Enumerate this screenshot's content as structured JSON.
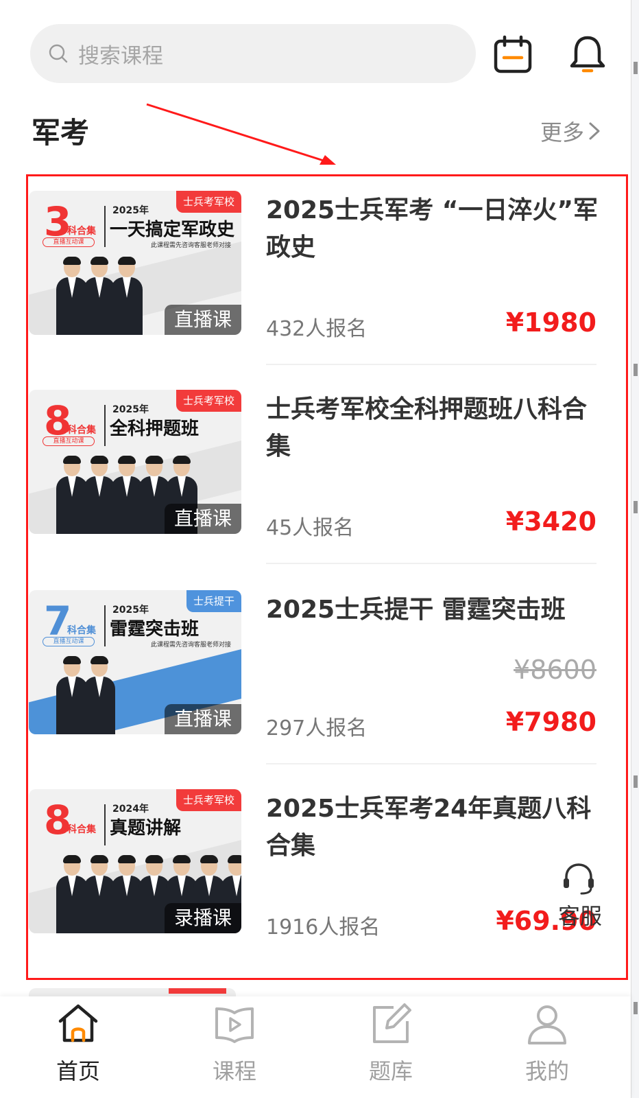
{
  "search": {
    "placeholder": "搜索课程"
  },
  "section": {
    "title": "军考",
    "more": "更多"
  },
  "courses": [
    {
      "title": "2025士兵军考 “一日淬火”军政史",
      "enroll": "432人报名",
      "price": "¥1980",
      "badge": "直播课",
      "thumb": {
        "tag": "士兵考军校",
        "num": "3",
        "kehe": "科合集",
        "live": "直播互动课",
        "year": "2025年",
        "headline": "一天搞定军政史",
        "sub": "此课程需先咨询客服老师对接"
      }
    },
    {
      "title": "士兵考军校全科押题班八科合集",
      "enroll": "45人报名",
      "price": "¥3420",
      "badge": "直播课",
      "thumb": {
        "tag": "士兵考军校",
        "num": "8",
        "kehe": "科合集",
        "live": "直播互动课",
        "year": "2025年",
        "headline": "全科押题班",
        "sub": ""
      }
    },
    {
      "title": "2025士兵提干 雷霆突击班",
      "enroll": "297人报名",
      "orig_price": "¥8600",
      "price": "¥7980",
      "badge": "直播课",
      "thumb": {
        "tag": "士兵提干",
        "num": "7",
        "kehe": "科合集",
        "live": "直播互动课",
        "year": "2025年",
        "headline": "雷霆突击班",
        "sub": "此课程需先咨询客服老师对接"
      }
    },
    {
      "title": "2025士兵军考24年真题八科合集",
      "enroll": "1916人报名",
      "price": "¥69.90",
      "badge": "录播课",
      "thumb": {
        "tag": "士兵考军校",
        "num": "8",
        "kehe": "科合集",
        "live": "",
        "year": "2024年",
        "headline": "真题讲解",
        "sub": ""
      }
    }
  ],
  "service": {
    "label": "客服"
  },
  "tabs": [
    {
      "label": "首页",
      "icon": "home-icon",
      "active": true
    },
    {
      "label": "课程",
      "icon": "play-icon",
      "active": false
    },
    {
      "label": "题库",
      "icon": "edit-icon",
      "active": false
    },
    {
      "label": "我的",
      "icon": "user-icon",
      "active": false
    }
  ],
  "colors": {
    "accent": "#f21c1c",
    "annotation": "#ff1a1a",
    "blue_tag": "#4f93dd",
    "orange_icon": "#ff8a00"
  }
}
